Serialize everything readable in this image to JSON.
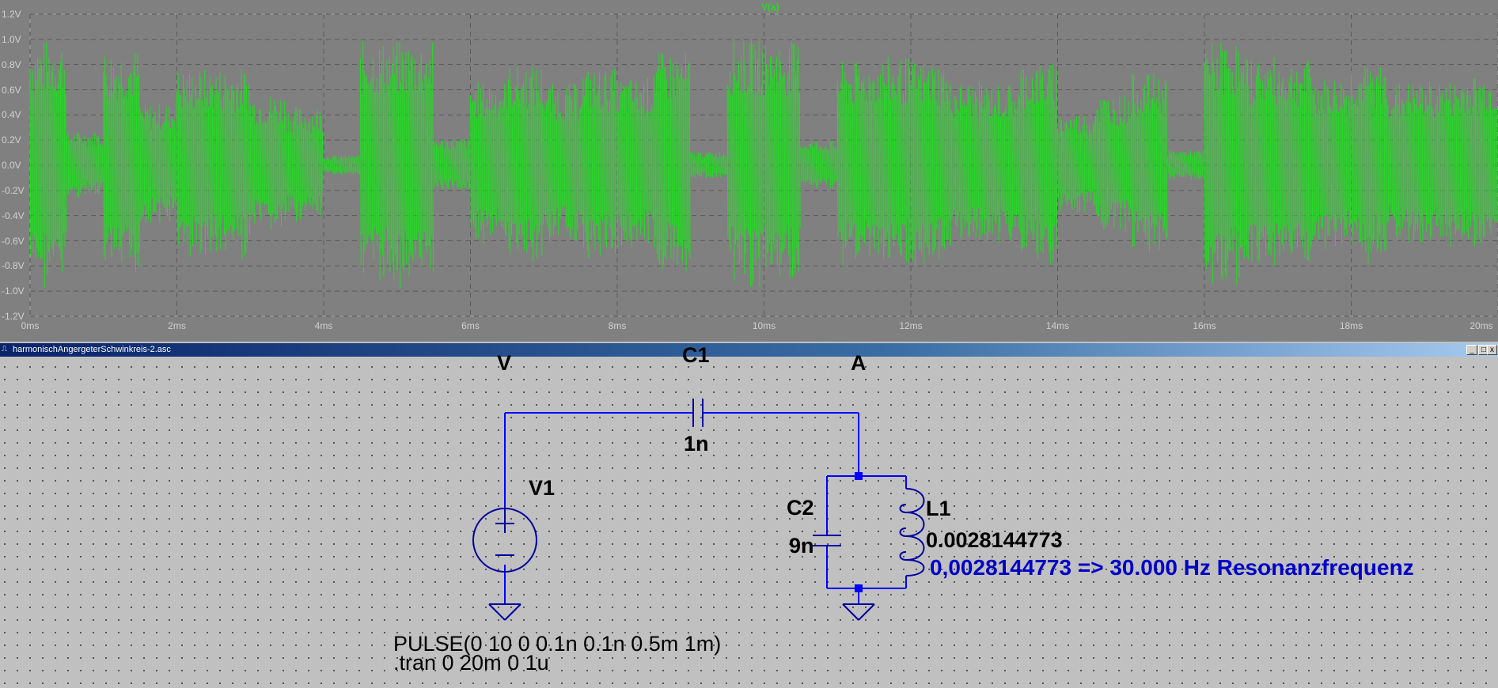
{
  "waveform": {
    "trace_name": "V(a)",
    "y_ticks": [
      "1.2V",
      "1.0V",
      "0.8V",
      "0.6V",
      "0.4V",
      "0.2V",
      "0.0V",
      "-0.2V",
      "-0.4V",
      "-0.6V",
      "-0.8V",
      "-1.0V",
      "-1.2V"
    ],
    "x_ticks": [
      "0ms",
      "2ms",
      "4ms",
      "6ms",
      "8ms",
      "10ms",
      "12ms",
      "14ms",
      "16ms",
      "18ms",
      "20ms"
    ],
    "colors": {
      "background": "#808080",
      "grid": "#5a5a5a",
      "trace": "#22dd22"
    },
    "chart_data": {
      "type": "line",
      "ylim": [
        -1.2,
        1.2
      ],
      "xlim": [
        0,
        20
      ],
      "x_unit": "ms",
      "y_unit": "V",
      "segments_ms": [
        0,
        0.5,
        1,
        1.5,
        2,
        2.5,
        3,
        3.5,
        4,
        4.5,
        5,
        5.5,
        6,
        6.5,
        7,
        7.5,
        8,
        8.5,
        9,
        9.5,
        10,
        10.5,
        11,
        11.5,
        12,
        12.5,
        13,
        13.5,
        14,
        14.5,
        15,
        15.5,
        16,
        16.5,
        17,
        17.5,
        18,
        18.5,
        19,
        19.5,
        20
      ],
      "envelope_amplitude_V": [
        1.0,
        0.27,
        0.93,
        0.5,
        0.77,
        0.78,
        0.57,
        0.47,
        0.08,
        0.99,
        0.99,
        0.22,
        0.67,
        0.8,
        0.65,
        0.77,
        0.7,
        0.9,
        0.11,
        1.0,
        0.99,
        0.2,
        0.82,
        0.86,
        0.83,
        0.67,
        0.65,
        0.82,
        0.42,
        0.57,
        0.73,
        0.12,
        0.99,
        0.86,
        0.84,
        0.7,
        0.8,
        0.66,
        0.67,
        0.72
      ]
    }
  },
  "window": {
    "title": "harmonischAngergeterSchwinkreis-2.asc",
    "minimize": "_",
    "restore": "□",
    "close": "x"
  },
  "schematic": {
    "net_v": "V",
    "net_a": "A",
    "c1_name": "C1",
    "c1_value": "1n",
    "v1_name": "V1",
    "c2_name": "C2",
    "c2_value": "9n",
    "l1_name": "L1",
    "l1_value": "0.0028144773",
    "comment": "0,0028144773 => 30.000 Hz Resonanzfrequenz",
    "source_spec": "PULSE(0 10 0 0.1n 0.1n 0.5m 1m)",
    "tran_directive": ".tran 0 20m 0 1u",
    "colors": {
      "wire": "#0000ff",
      "component": "#0000a0",
      "comment": "#0000c8"
    }
  }
}
